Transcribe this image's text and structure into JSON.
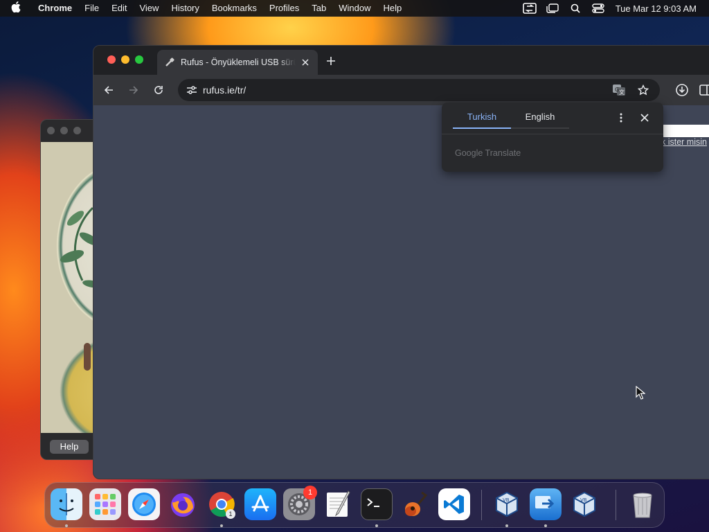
{
  "menubar": {
    "app_name": "Chrome",
    "items": [
      "File",
      "Edit",
      "View",
      "History",
      "Bookmarks",
      "Profiles",
      "Tab",
      "Window",
      "Help"
    ],
    "clock": "Tue Mar 12  9:03 AM"
  },
  "background_window": {
    "help_label": "Help"
  },
  "browser": {
    "tab": {
      "title": "Rufus - Önyüklemeli USB sürücüleri"
    },
    "url": "rufus.ie/tr/",
    "page": {
      "link_fragment": "k ister misin"
    },
    "translate_popup": {
      "tabs": [
        {
          "label": "Turkish",
          "active": true
        },
        {
          "label": "English",
          "active": false
        }
      ],
      "brand": "Google Translate"
    }
  },
  "dock": {
    "apps": [
      "Finder",
      "Launchpad",
      "Safari",
      "Firefox",
      "Chrome",
      "App Store",
      "System Settings",
      "TextEdit",
      "Terminal",
      "GarageBand",
      "Visual Studio Code",
      "VirtualBox",
      "Migration Assistant",
      "VirtualBox VM",
      "Trash"
    ],
    "settings_badge": "1",
    "chrome_badge": "1"
  },
  "colors": {
    "accent": "#8ab4f8",
    "content_bg": "#3f4556",
    "toolbar_bg": "#35363a"
  }
}
